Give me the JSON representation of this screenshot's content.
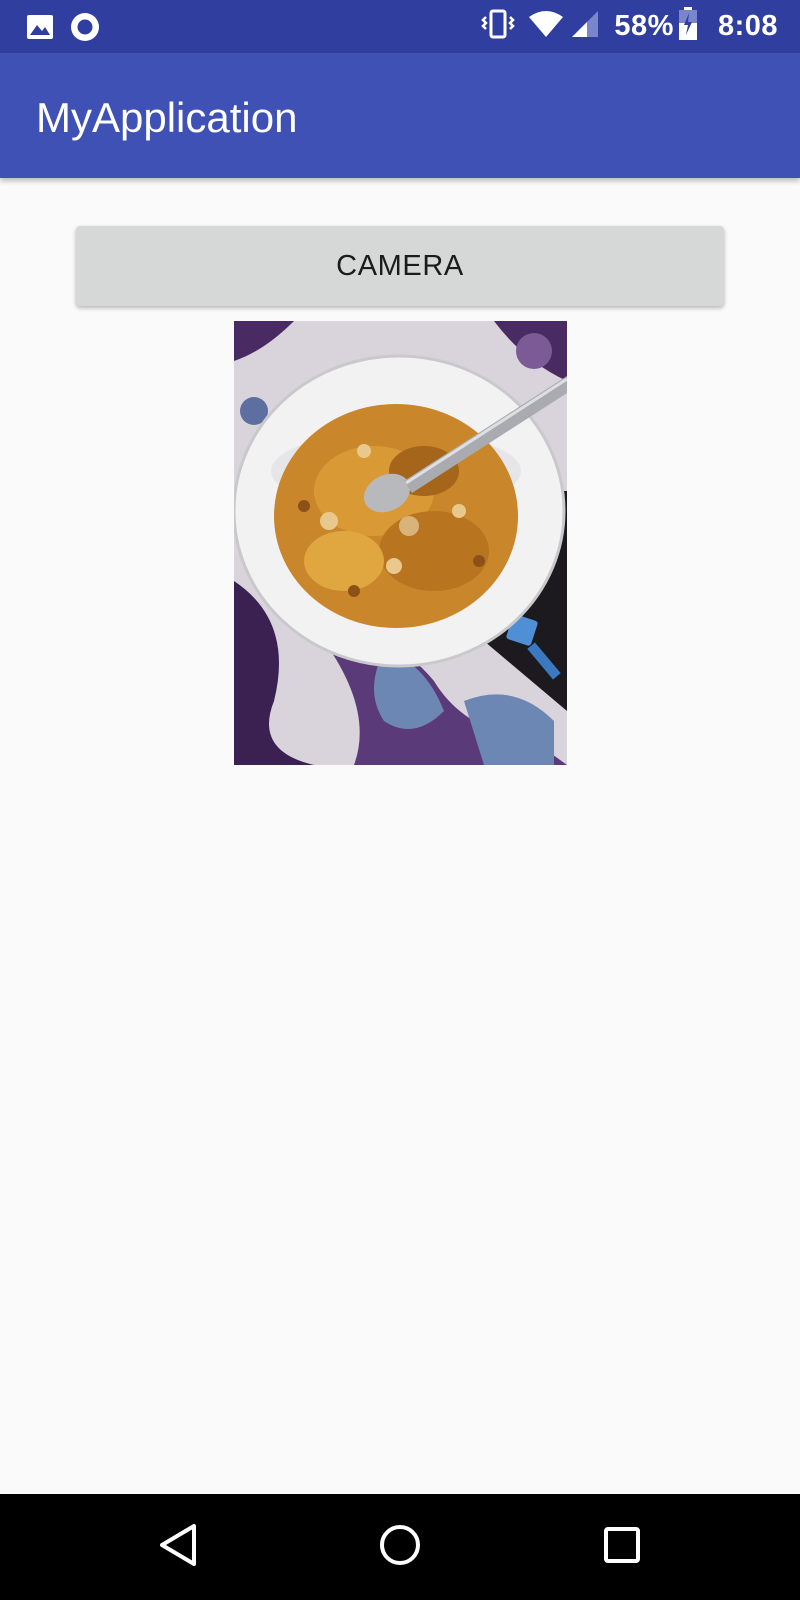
{
  "status_bar": {
    "left_icons": [
      "image-icon",
      "record-icon"
    ],
    "right_icons": [
      "vibrate-icon",
      "wifi-icon",
      "signal-icon",
      "battery-icon"
    ],
    "battery_percent": "58%",
    "time": "8:08"
  },
  "app_bar": {
    "title": "MyApplication",
    "color": "#3f51b5",
    "status_color": "#303f9f"
  },
  "main": {
    "camera_button_label": "CAMERA",
    "photo": {
      "description_icon": "cereal-bowl-photo"
    }
  },
  "nav_bar": {
    "buttons": [
      "back-icon",
      "home-icon",
      "recents-icon"
    ]
  }
}
